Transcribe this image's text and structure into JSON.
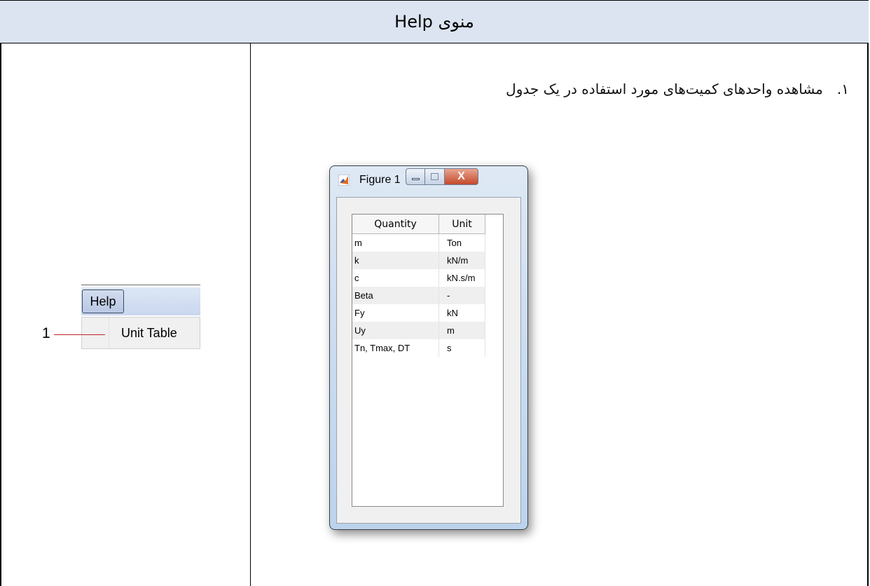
{
  "header": {
    "title": "منوی Help"
  },
  "menu": {
    "menu_label": "Help",
    "item_label": "Unit Table",
    "callout_number": "1"
  },
  "description": {
    "number": "۱.",
    "text": "مشاهده واحدهای کمیت‌های مورد استفاده در یک جدول"
  },
  "figure_window": {
    "title": "Figure 1",
    "close_glyph": "X",
    "columns": [
      "Quantity",
      "Unit"
    ],
    "rows": [
      {
        "quantity": "m",
        "unit": "Ton"
      },
      {
        "quantity": "k",
        "unit": "kN/m"
      },
      {
        "quantity": "c",
        "unit": "kN.s/m"
      },
      {
        "quantity": "Beta",
        "unit": "-"
      },
      {
        "quantity": "Fy",
        "unit": "kN"
      },
      {
        "quantity": "Uy",
        "unit": "m"
      },
      {
        "quantity": "Tn, Tmax, DT",
        "unit": "s"
      }
    ]
  },
  "colors": {
    "header_bg": "#dbe4f0",
    "callout_line": "#c0262c",
    "close_button": "#c4492c"
  },
  "icons": [
    "matlab-logo-icon",
    "minimize-icon",
    "maximize-icon",
    "close-icon"
  ]
}
